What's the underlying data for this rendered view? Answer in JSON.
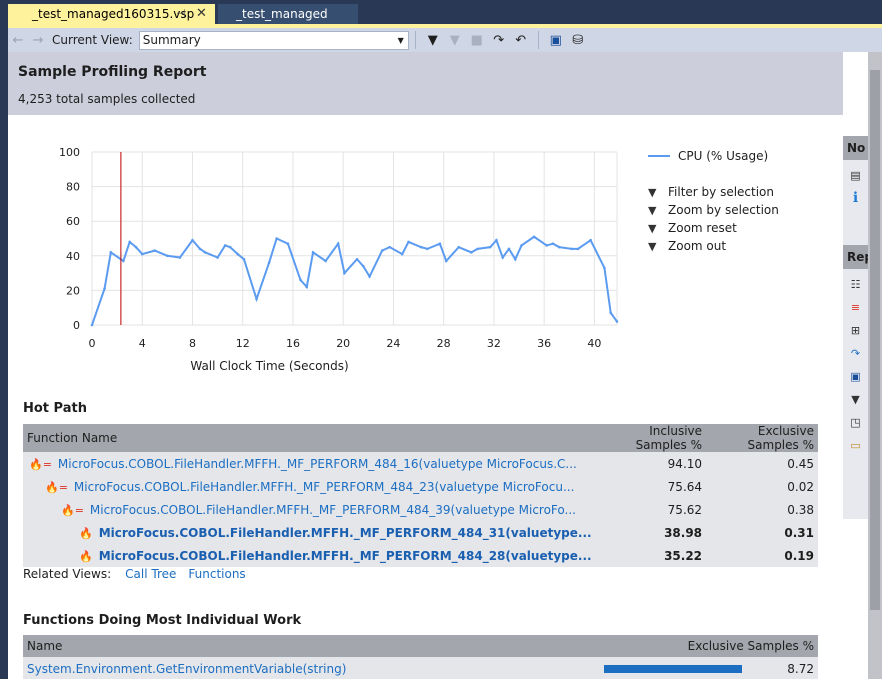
{
  "tabs": [
    {
      "label": "_test_managed160315.vsp",
      "active": true
    },
    {
      "label": "_test_managed",
      "active": false
    }
  ],
  "toolbar": {
    "current_view_label": "Current View:",
    "current_view_value": "Summary"
  },
  "report": {
    "title": "Sample Profiling Report",
    "subtitle": "4,253 total samples collected"
  },
  "chart_data": {
    "type": "line",
    "xlabel": "Wall Clock Time (Seconds)",
    "ylabel": "",
    "xlim": [
      0,
      41.8
    ],
    "ylim": [
      0,
      100
    ],
    "xticks": [
      0,
      4,
      8,
      12,
      16,
      20,
      24,
      28,
      32,
      36,
      40
    ],
    "yticks": [
      0,
      20,
      40,
      60,
      80,
      100
    ],
    "cursor_x": 2.3,
    "series": [
      {
        "name": "CPU (% Usage)",
        "color": "#5b9bf0",
        "x": [
          0,
          1.0,
          1.5,
          2.5,
          3.0,
          3.5,
          4.0,
          5.0,
          6.0,
          7.0,
          8.0,
          8.6,
          9.0,
          10.0,
          10.6,
          11.0,
          11.6,
          12.1,
          13.1,
          14.1,
          14.7,
          15.6,
          16.6,
          17.1,
          17.6,
          18.6,
          19.6,
          20.1,
          21.1,
          21.6,
          22.1,
          23.1,
          23.7,
          24.7,
          25.2,
          26.2,
          26.7,
          27.7,
          28.2,
          29.2,
          30.2,
          30.7,
          31.7,
          32.2,
          32.7,
          33.2,
          33.7,
          34.2,
          35.2,
          36.2,
          36.7,
          37.2,
          38.2,
          38.7,
          39.7,
          40.8,
          41.3,
          41.8
        ],
        "y": [
          0,
          21,
          42,
          37,
          48,
          45,
          41,
          43,
          40,
          39,
          49,
          44,
          42,
          39,
          46,
          45,
          41,
          38,
          15,
          36,
          50,
          47,
          26,
          22,
          42,
          37,
          47,
          30,
          38,
          34,
          28,
          43,
          45,
          41,
          48,
          45,
          44,
          47,
          37,
          45,
          42,
          44,
          45,
          49,
          39,
          44,
          38,
          46,
          51,
          46,
          47,
          45,
          44,
          44,
          49,
          33,
          7,
          2
        ]
      }
    ],
    "legend": "right"
  },
  "legend_actions": [
    "Filter by selection",
    "Zoom by selection",
    "Zoom reset",
    "Zoom out"
  ],
  "hot_path": {
    "title": "Hot Path",
    "columns": [
      "Function Name",
      "Inclusive Samples %",
      "Exclusive Samples %"
    ],
    "rows": [
      {
        "name": "MicroFocus.COBOL.FileHandler.MFFH._MF_PERFORM_484_16(valuetype MicroFocus.C...",
        "inclusive": "94.10",
        "exclusive": "0.45",
        "hot": false
      },
      {
        "name": "MicroFocus.COBOL.FileHandler.MFFH._MF_PERFORM_484_23(valuetype MicroFocu...",
        "inclusive": "75.64",
        "exclusive": "0.02",
        "hot": false
      },
      {
        "name": "MicroFocus.COBOL.FileHandler.MFFH._MF_PERFORM_484_39(valuetype MicroFo...",
        "inclusive": "75.62",
        "exclusive": "0.38",
        "hot": false
      },
      {
        "name": "MicroFocus.COBOL.FileHandler.MFFH._MF_PERFORM_484_31(valuetype...",
        "inclusive": "38.98",
        "exclusive": "0.31",
        "hot": true
      },
      {
        "name": "MicroFocus.COBOL.FileHandler.MFFH._MF_PERFORM_484_28(valuetype...",
        "inclusive": "35.22",
        "exclusive": "0.19",
        "hot": true
      }
    ]
  },
  "related": {
    "label": "Related Views:",
    "links": [
      "Call Tree",
      "Functions"
    ]
  },
  "individual": {
    "title": "Functions Doing Most Individual Work",
    "columns": [
      "Name",
      "Exclusive Samples %"
    ],
    "rows": [
      {
        "name": "System.Environment.GetEnvironmentVariable(string)",
        "exclusive": "8.72"
      }
    ]
  },
  "side_panels": {
    "notifications": "No",
    "report": "Rep"
  }
}
